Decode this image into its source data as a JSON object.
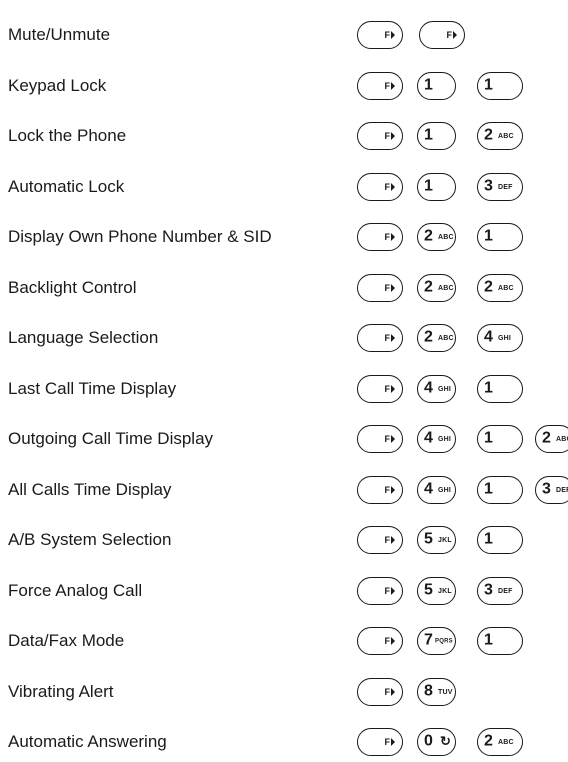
{
  "rows": [
    {
      "label": "Mute/Unmute",
      "keys": [
        {
          "type": "f",
          "text": "F"
        },
        {
          "type": "f",
          "text": "F"
        }
      ]
    },
    {
      "label": "Keypad Lock",
      "keys": [
        {
          "type": "f",
          "text": "F"
        },
        {
          "type": "num",
          "digit": "1",
          "letters": ""
        },
        {
          "type": "num",
          "digit": "1",
          "letters": ""
        }
      ]
    },
    {
      "label": "Lock the Phone",
      "keys": [
        {
          "type": "f",
          "text": "F"
        },
        {
          "type": "num",
          "digit": "1",
          "letters": ""
        },
        {
          "type": "num",
          "digit": "2",
          "letters": "ABC"
        }
      ]
    },
    {
      "label": "Automatic Lock",
      "keys": [
        {
          "type": "f",
          "text": "F"
        },
        {
          "type": "num",
          "digit": "1",
          "letters": ""
        },
        {
          "type": "num",
          "digit": "3",
          "letters": "DEF"
        }
      ]
    },
    {
      "label": "Display Own Phone Number & SID",
      "keys": [
        {
          "type": "f",
          "text": "F"
        },
        {
          "type": "num",
          "digit": "2",
          "letters": "ABC"
        },
        {
          "type": "num",
          "digit": "1",
          "letters": ""
        }
      ]
    },
    {
      "label": "Backlight Control",
      "keys": [
        {
          "type": "f",
          "text": "F"
        },
        {
          "type": "num",
          "digit": "2",
          "letters": "ABC"
        },
        {
          "type": "num",
          "digit": "2",
          "letters": "ABC"
        }
      ]
    },
    {
      "label": "Language Selection",
      "keys": [
        {
          "type": "f",
          "text": "F"
        },
        {
          "type": "num",
          "digit": "2",
          "letters": "ABC"
        },
        {
          "type": "num",
          "digit": "4",
          "letters": "GHI"
        }
      ]
    },
    {
      "label": "Last Call Time Display",
      "keys": [
        {
          "type": "f",
          "text": "F"
        },
        {
          "type": "num",
          "digit": "4",
          "letters": "GHI"
        },
        {
          "type": "num",
          "digit": "1",
          "letters": ""
        }
      ]
    },
    {
      "label": "Outgoing Call Time Display",
      "keys": [
        {
          "type": "f",
          "text": "F"
        },
        {
          "type": "num",
          "digit": "4",
          "letters": "GHI"
        },
        {
          "type": "num",
          "digit": "1",
          "letters": ""
        },
        {
          "type": "num",
          "digit": "2",
          "letters": "ABC"
        }
      ]
    },
    {
      "label": "All Calls Time Display",
      "keys": [
        {
          "type": "f",
          "text": "F"
        },
        {
          "type": "num",
          "digit": "4",
          "letters": "GHI"
        },
        {
          "type": "num",
          "digit": "1",
          "letters": ""
        },
        {
          "type": "num",
          "digit": "3",
          "letters": "DEF"
        }
      ]
    },
    {
      "label": "A/B System Selection",
      "keys": [
        {
          "type": "f",
          "text": "F"
        },
        {
          "type": "num",
          "digit": "5",
          "letters": "JKL"
        },
        {
          "type": "num",
          "digit": "1",
          "letters": ""
        }
      ]
    },
    {
      "label": "Force Analog Call",
      "keys": [
        {
          "type": "f",
          "text": "F"
        },
        {
          "type": "num",
          "digit": "5",
          "letters": "JKL"
        },
        {
          "type": "num",
          "digit": "3",
          "letters": "DEF"
        }
      ]
    },
    {
      "label": "Data/Fax  Mode",
      "keys": [
        {
          "type": "f",
          "text": "F"
        },
        {
          "type": "num",
          "digit": "7",
          "letters": "PQRS"
        },
        {
          "type": "num",
          "digit": "1",
          "letters": ""
        }
      ]
    },
    {
      "label": "Vibrating Alert",
      "keys": [
        {
          "type": "f",
          "text": "F"
        },
        {
          "type": "num",
          "digit": "8",
          "letters": "TUV"
        }
      ]
    },
    {
      "label": "Automatic Answering",
      "keys": [
        {
          "type": "f",
          "text": "F"
        },
        {
          "type": "zero",
          "digit": "0",
          "symbol": "↻"
        },
        {
          "type": "num",
          "digit": "2",
          "letters": "ABC"
        }
      ]
    }
  ]
}
